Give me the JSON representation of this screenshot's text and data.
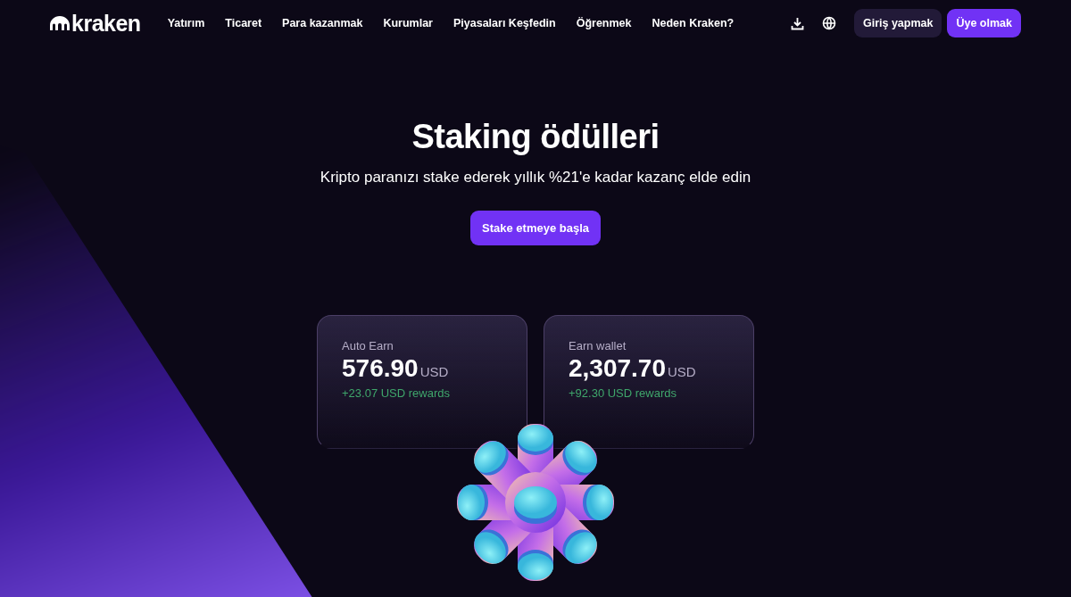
{
  "header": {
    "logo": "kraken",
    "nav": [
      "Yatırım",
      "Ticaret",
      "Para kazanmak",
      "Kurumlar",
      "Piyasaları Keşfedin",
      "Öğrenmek",
      "Neden Kraken?"
    ],
    "login": "Giriş yapmak",
    "signup": "Üye olmak"
  },
  "hero": {
    "title": "Staking ödülleri",
    "subtitle": "Kripto paranızı stake ederek yıllık %21'e kadar kazanç elde edin",
    "cta": "Stake etmeye başla"
  },
  "cards": [
    {
      "label": "Auto Earn",
      "amount": "576.90",
      "currency": "USD",
      "rewards": "+23.07 USD rewards"
    },
    {
      "label": "Earn wallet",
      "amount": "2,307.70",
      "currency": "USD",
      "rewards": "+92.30 USD rewards"
    }
  ]
}
